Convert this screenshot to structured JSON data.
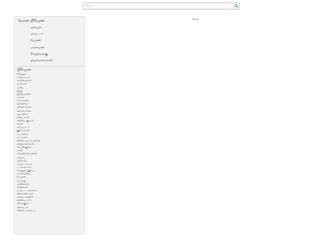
{
  "search": {
    "placeholder": "தேடு ......"
  },
  "nav": {
    "title": "நேரான பிரிவுகள்",
    "items": [
      {
        "label": "அரசியல்"
      },
      {
        "label": "மாவட்டம்"
      },
      {
        "label": "பேருகள்"
      },
      {
        "label": "மனைவகள்"
      },
      {
        "label": "செய்திகளுக்கு"
      },
      {
        "label": "பிரபலமானவர்கள்"
      }
    ]
  },
  "categories": {
    "title": "பிரிவுகள்",
    "items": [
      {
        "label": "//மேலும்"
      },
      {
        "label": "அமைப்பு உ"
      },
      {
        "label": "அறிவியல்கள்"
      },
      {
        "label": "அரசியல்"
      },
      {
        "label": "அறிவு"
      },
      {
        "label": "இந்து"
      },
      {
        "label": "இந்தியாவின்"
      },
      {
        "label": "உலகம்"
      },
      {
        "label": "உலக வகை"
      },
      {
        "label": "ஊர்களைத"
      },
      {
        "label": "ஊர்கள் வகை"
      },
      {
        "label": "ஊர்கள் வகை"
      },
      {
        "label": "ஒரு பிரிவு"
      },
      {
        "label": "கண்டி கட்சி"
      },
      {
        "label": "கன்னியாகுமாரி"
      },
      {
        "label": "கல்வி"
      },
      {
        "label": "கம்ப்யூட்டர்"
      },
      {
        "label": "குடும்பத் தி"
      },
      {
        "label": "கட்டங்கள்"
      },
      {
        "label": "சட்டங்கள்"
      },
      {
        "label": "சினிமா பாடல் வரிகள்"
      },
      {
        "label": "சுற்றுலாதளங்கள்"
      },
      {
        "label": "செய்திக்குறை"
      },
      {
        "label": "தமிழ்"
      },
      {
        "label": "தொழில் செய்திகள்"
      },
      {
        "label": "புதியவ"
      },
      {
        "label": "பண்டிகை"
      },
      {
        "label": "பரதநாட்டியம்"
      },
      {
        "label": "படங்கள் நாம்"
      },
      {
        "label": "மருத்துவ குறிப்பு"
      },
      {
        "label": "புலவர்களைப்"
      },
      {
        "label": "பேருகள்"
      },
      {
        "label": "பேருந்து"
      },
      {
        "label": "மனைவகள்"
      },
      {
        "label": "மன்னர்கள்"
      },
      {
        "label": "மாவட்ட மாநகராம்"
      },
      {
        "label": "வினாவிடைகள்"
      },
      {
        "label": "வர்த்தக விதிகள்"
      },
      {
        "label": "விளையாட்டு"
      },
      {
        "label": "விலங்குகள்"
      },
      {
        "label": "விளம்பரம்"
      },
      {
        "label": "TNPSC முக்கியம்"
      }
    ]
  },
  "colors": {
    "sidebar_bg": "#f2f2f2",
    "search_icon": "#2e9d4a",
    "text": "#333333"
  }
}
